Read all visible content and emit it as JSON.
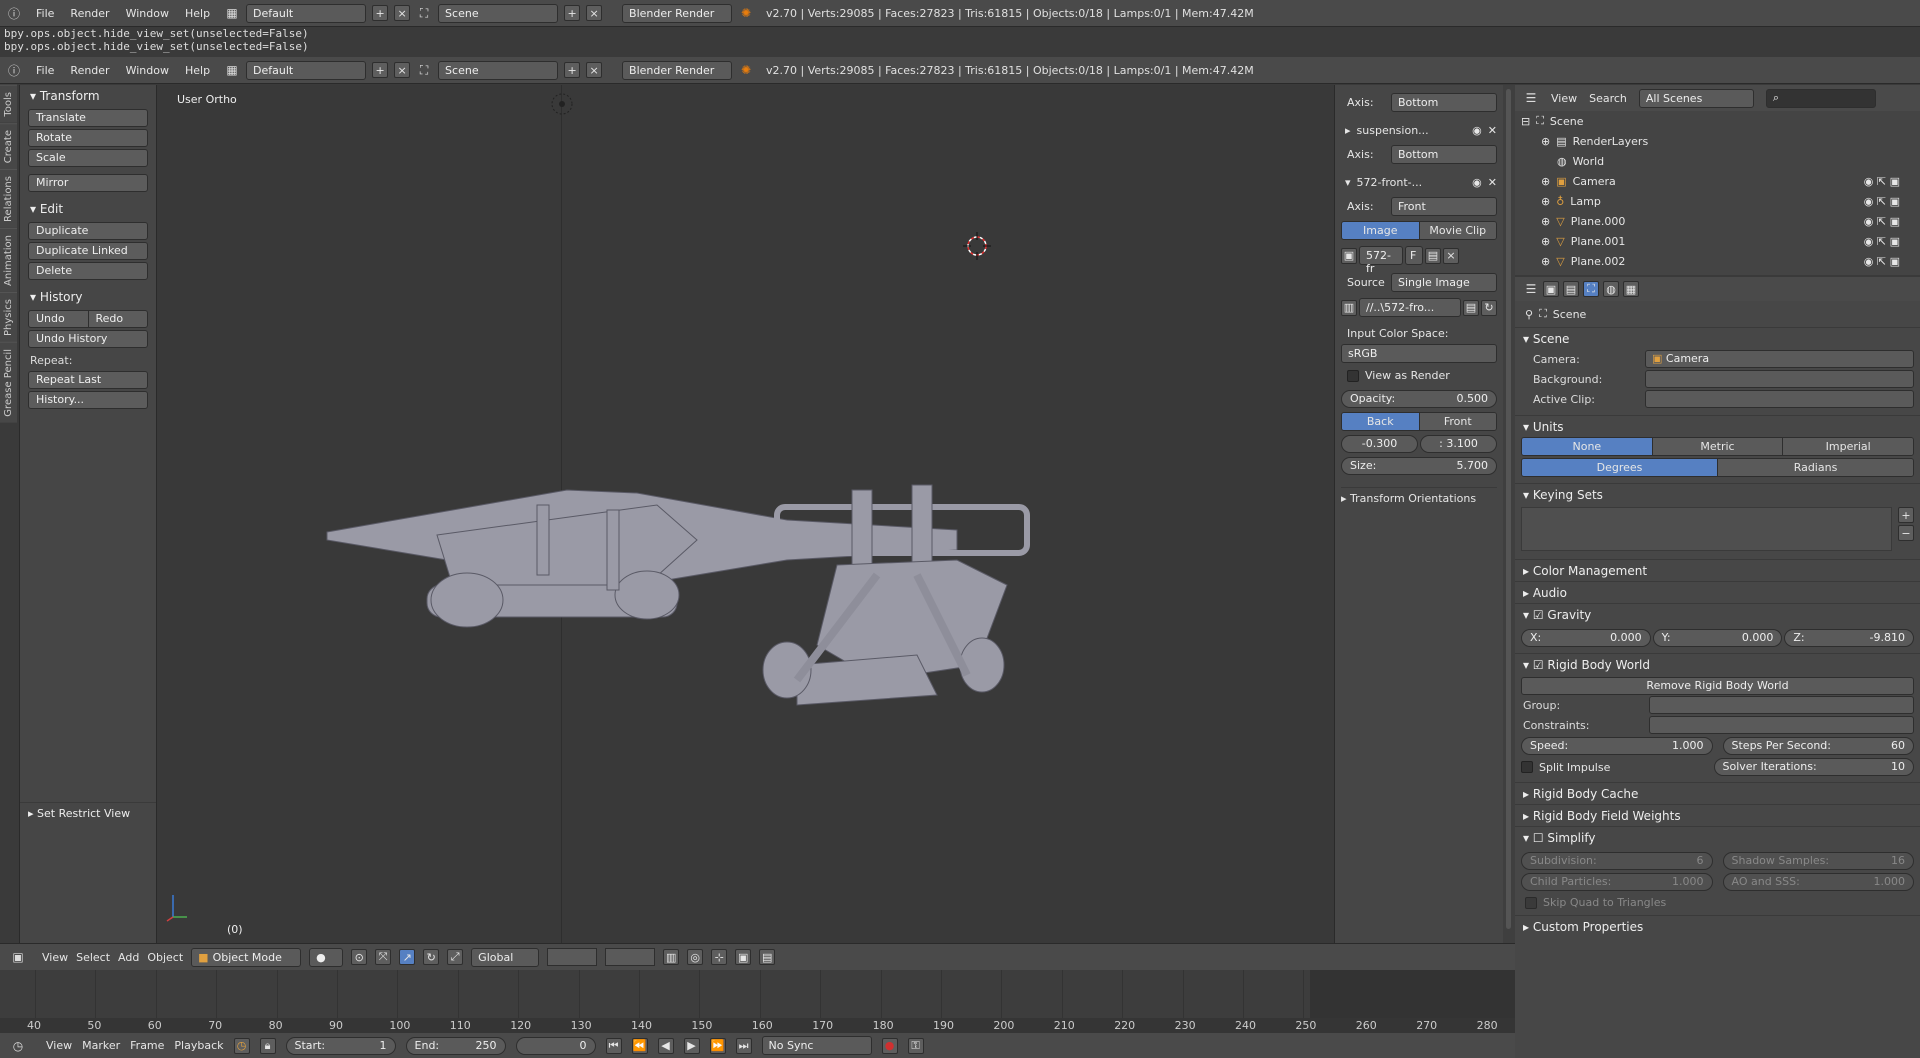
{
  "top_header": {
    "menu": [
      "File",
      "Render",
      "Window",
      "Help"
    ],
    "layout": "Default",
    "scene": "Scene",
    "engine": "Blender Render",
    "stats": "v2.70 | Verts:29085 | Faces:27823 | Tris:61815 | Objects:0/18 | Lamps:0/1 | Mem:47.42M"
  },
  "console": {
    "lines": [
      "bpy.ops.object.hide_view_set(unselected=False)",
      "bpy.ops.object.hide_view_set(unselected=False)"
    ]
  },
  "tabs": [
    "Tools",
    "Create",
    "Relations",
    "Animation",
    "Physics",
    "Grease Pencil"
  ],
  "toolshelf": {
    "transform": {
      "title": "Transform",
      "items": [
        "Translate",
        "Rotate",
        "Scale",
        "Mirror"
      ]
    },
    "edit": {
      "title": "Edit",
      "items": [
        "Duplicate",
        "Duplicate Linked",
        "Delete"
      ]
    },
    "history": {
      "title": "History",
      "undo": "Undo",
      "redo": "Redo",
      "undo_history": "Undo History",
      "repeat_label": "Repeat:",
      "repeat_last": "Repeat Last",
      "history_menu": "History..."
    },
    "restrict": "Set Restrict View"
  },
  "viewport": {
    "label": "User Ortho",
    "frame": "(0)"
  },
  "npanel": {
    "axis_label": "Axis:",
    "axis1": "Bottom",
    "bg2_name": "suspension...",
    "axis2": "Bottom",
    "bg3_name": "572-front-...",
    "axis3": "Front",
    "image_tab": "Image",
    "movie_tab": "Movie Clip",
    "image_name": "572-fr",
    "f_label": "F",
    "source_label": "Source",
    "source": "Single Image",
    "path": "//..\\572-fro...",
    "color_space_label": "Input Color Space:",
    "color_space": "sRGB",
    "view_as_render": "View as Render",
    "opacity_label": "Opacity:",
    "opacity": "0.500",
    "back": "Back",
    "front": "Front",
    "offset_x": "-0.300",
    "offset_y": ": 3.100",
    "size_label": "Size:",
    "size": "5.700",
    "transform_orientations": "Transform Orientations"
  },
  "outliner": {
    "view": "View",
    "search": "Search",
    "scenes": "All Scenes",
    "items": [
      "Scene",
      "RenderLayers",
      "World",
      "Camera",
      "Lamp",
      "Plane.000",
      "Plane.001",
      "Plane.002"
    ]
  },
  "properties": {
    "context": "Scene",
    "scene_title": "Scene",
    "camera_label": "Camera:",
    "camera": "Camera",
    "background_label": "Background:",
    "active_clip_label": "Active Clip:",
    "units_title": "Units",
    "units": [
      "None",
      "Metric",
      "Imperial"
    ],
    "rot": [
      "Degrees",
      "Radians"
    ],
    "keying_sets": "Keying Sets",
    "color_management": "Color Management",
    "audio": "Audio",
    "gravity": "Gravity",
    "gx": "0.000",
    "gy": "0.000",
    "gz": "-9.810",
    "x_label": "X:",
    "y_label": "Y:",
    "z_label": "Z:",
    "rigid_body_world": "Rigid Body World",
    "remove_rbw": "Remove Rigid Body World",
    "group_label": "Group:",
    "constraints_label": "Constraints:",
    "speed_label": "Speed:",
    "speed": "1.000",
    "steps_label": "Steps Per Second:",
    "steps": "60",
    "split_impulse": "Split Impulse",
    "solver_label": "Solver Iterations:",
    "solver": "10",
    "rb_cache": "Rigid Body Cache",
    "rb_field": "Rigid Body Field Weights",
    "simplify": "Simplify",
    "subdiv_label": "Subdivision:",
    "subdiv": "6",
    "shadow_label": "Shadow Samples:",
    "shadow": "16",
    "child_label": "Child Particles:",
    "child": "1.000",
    "ao_label": "AO and SSS:",
    "ao": "1.000",
    "skip_quad": "Skip Quad to Triangles",
    "custom_props": "Custom Properties"
  },
  "vp_header": {
    "menu": [
      "View",
      "Select",
      "Add",
      "Object"
    ],
    "mode": "Object Mode",
    "orientation": "Global"
  },
  "timeline": {
    "ticks": [
      "40",
      "50",
      "60",
      "70",
      "80",
      "90",
      "100",
      "110",
      "120",
      "130",
      "140",
      "150",
      "160",
      "170",
      "180",
      "190",
      "200",
      "210",
      "220",
      "230",
      "240",
      "250",
      "260",
      "270",
      "280"
    ]
  },
  "tl_header": {
    "menu": [
      "View",
      "Marker",
      "Frame",
      "Playback"
    ],
    "start_label": "Start:",
    "start": "1",
    "end_label": "End:",
    "end": "250",
    "current": "0",
    "sync": "No Sync"
  }
}
